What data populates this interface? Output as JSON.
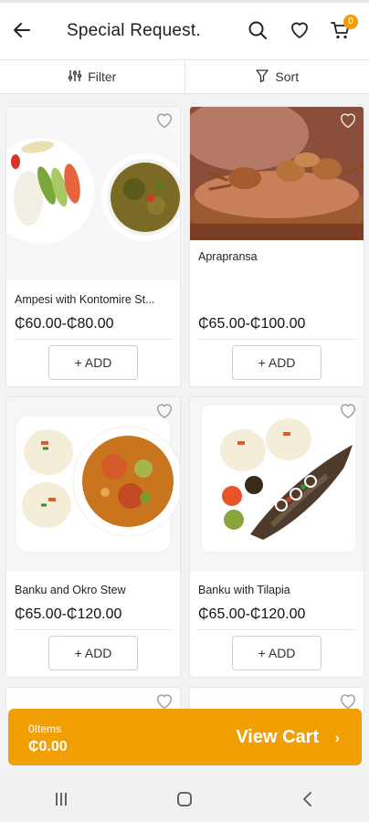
{
  "header": {
    "title": "Special Request.",
    "cart_count": "0"
  },
  "toolbar": {
    "filter_label": "Filter",
    "sort_label": "Sort"
  },
  "products": [
    {
      "name": "Ampesi with Kontomire St...",
      "price": "₵60.00-₵80.00",
      "add_label": "+ ADD"
    },
    {
      "name": "Aprapransa",
      "price": "₵65.00-₵100.00",
      "add_label": "+ ADD"
    },
    {
      "name": "Banku and Okro Stew",
      "price": "₵65.00-₵120.00",
      "add_label": "+ ADD"
    },
    {
      "name": "Banku with Tilapia",
      "price": "₵65.00-₵120.00",
      "add_label": "+ ADD"
    }
  ],
  "cart": {
    "items_label": "0Items",
    "total": "₵0.00",
    "view_label": "View Cart",
    "chevron": "›"
  },
  "colors": {
    "accent": "#f29f05"
  },
  "icons": [
    "back-arrow-icon",
    "search-icon",
    "heart-icon",
    "cart-icon",
    "filter-icon",
    "sort-icon",
    "recent-apps-icon",
    "home-icon",
    "back-icon"
  ]
}
